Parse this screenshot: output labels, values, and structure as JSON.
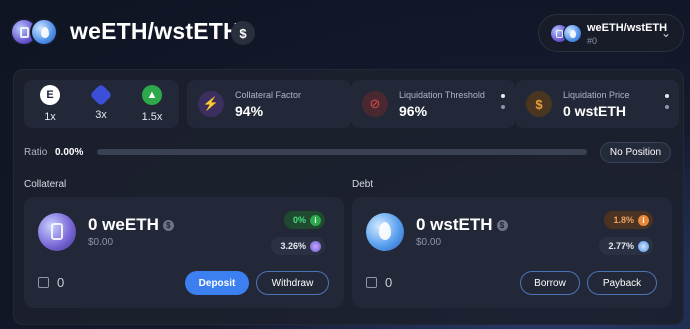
{
  "header": {
    "title": "weETH/wstETH",
    "currency_badge": "$",
    "position_select": {
      "name": "weETH/wstETH",
      "id": "#0"
    }
  },
  "leverage": [
    {
      "icon": "protocol-e-icon",
      "value": "1x",
      "color": "#ffffff"
    },
    {
      "icon": "protocol-grid-icon",
      "value": "3x",
      "color": "#3b4fd8"
    },
    {
      "icon": "protocol-green-icon",
      "value": "1.5x",
      "color": "#2da84a"
    }
  ],
  "stats": [
    {
      "icon": "bolt-icon",
      "label": "Collateral Factor",
      "value": "94%"
    },
    {
      "icon": "prohibited-icon",
      "label": "Liquidation Threshold",
      "value": "96%"
    },
    {
      "icon": "dollar-icon",
      "label": "Liquidation Price",
      "value": "0 wstETH"
    }
  ],
  "ratio": {
    "label": "Ratio",
    "value": "0.00%",
    "fill": 0,
    "status": "No Position"
  },
  "collateral": {
    "label": "Collateral",
    "amount": "0 weETH",
    "usd": "$0.00",
    "rate_primary": "0%",
    "rate_secondary": "3.26%",
    "wallet_balance": "0",
    "deposit": "Deposit",
    "withdraw": "Withdraw"
  },
  "debt": {
    "label": "Debt",
    "amount": "0 wstETH",
    "usd": "$0.00",
    "rate_primary": "1.8%",
    "rate_secondary": "2.77%",
    "wallet_balance": "0",
    "borrow": "Borrow",
    "payback": "Payback"
  },
  "colors": {
    "accent": "#3b7ff0",
    "green": "#2da84a",
    "orange": "#e8893a",
    "panel": "#222837"
  }
}
